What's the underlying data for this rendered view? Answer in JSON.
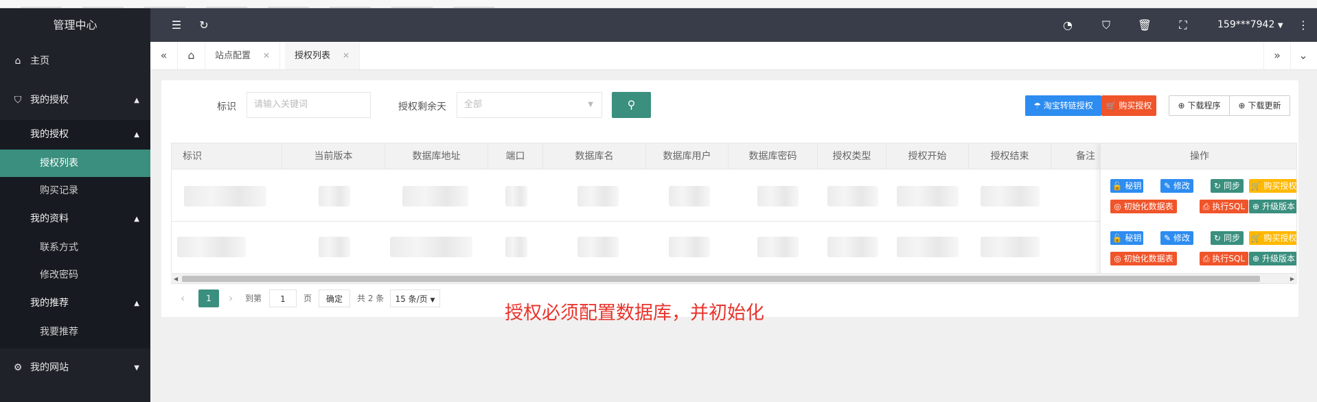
{
  "sidebar": {
    "logo": "管理中心",
    "home": "主页",
    "auth_menu": "我的授权",
    "auth_sub_head": "我的授权",
    "auth_list": "授权列表",
    "buy_record": "购买记录",
    "profile_head": "我的资料",
    "contact": "联系方式",
    "change_pwd": "修改密码",
    "recommend_head": "我的推荐",
    "recommend": "我要推荐",
    "website": "我的网站"
  },
  "header": {
    "user": "159***7942"
  },
  "tabs": {
    "site_config": "站点配置",
    "auth_list": "授权列表"
  },
  "filter": {
    "label_id": "标识",
    "id_placeholder": "请输入关键词",
    "label_days": "授权剩余天",
    "days_value": "全部"
  },
  "toolbar": {
    "taobao": "淘宝转链授权",
    "buy": "购买授权",
    "download_program": "下载程序",
    "download_update": "下载更新"
  },
  "table": {
    "columns": [
      "标识",
      "当前版本",
      "数据库地址",
      "端口",
      "数据库名",
      "数据库用户",
      "数据库密码",
      "授权类型",
      "授权开始",
      "授权结束",
      "备注"
    ],
    "ops_header": "操作",
    "ops": {
      "secret": "秘钥",
      "edit": "修改",
      "sync": "同步",
      "buy": "购买授权",
      "init_db": "初始化数据表",
      "exec_sql": "执行SQL",
      "upgrade": "升级版本"
    }
  },
  "pager": {
    "current": "1",
    "goto": "到第",
    "page_input": "1",
    "page_unit": "页",
    "confirm": "确定",
    "total": "共 2 条",
    "per_page": "15 条/页"
  },
  "annotation": "授权必须配置数据库，并初始化",
  "colors": {
    "sidebar": "#20222a",
    "header": "#393d49",
    "accent": "#3a8f7e",
    "blue": "#2d8cf0",
    "orange": "#f0542a",
    "yellow": "#ffb800",
    "note": "#e8342c"
  }
}
